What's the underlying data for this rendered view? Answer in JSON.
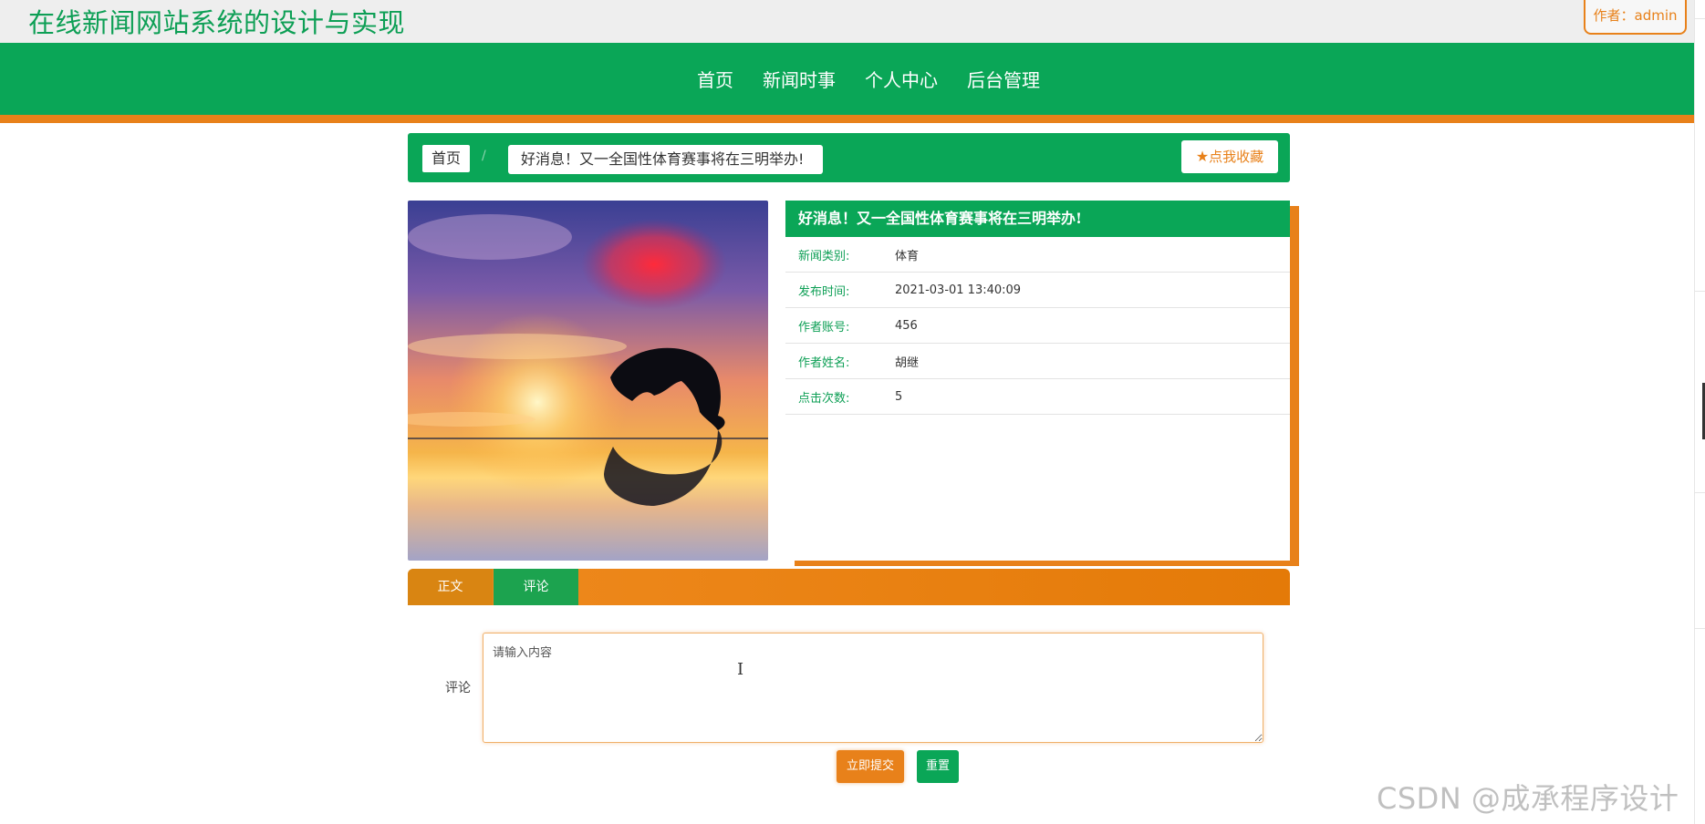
{
  "header": {
    "site_title": "在线新闻网站系统的设计与实现",
    "author_badge": "作者：admin"
  },
  "nav": {
    "items": [
      {
        "label": "首页"
      },
      {
        "label": "新闻时事"
      },
      {
        "label": "个人中心"
      },
      {
        "label": "后台管理"
      }
    ]
  },
  "breadcrumb": {
    "home": "首页",
    "separator": "/",
    "current": "好消息！又一全国性体育赛事将在三明举办!",
    "favorite_icon": "star-icon",
    "favorite_label": "点我收藏"
  },
  "news": {
    "image_alt": "dolphin-sunset-image",
    "title": "好消息！又一全国性体育赛事将在三明举办!",
    "fields": [
      {
        "label": "新闻类别:",
        "value": "体育"
      },
      {
        "label": "发布时间:",
        "value": "2021-03-01 13:40:09"
      },
      {
        "label": "作者账号:",
        "value": "456"
      },
      {
        "label": "作者姓名:",
        "value": "胡继"
      },
      {
        "label": "点击次数:",
        "value": "5"
      }
    ]
  },
  "tabs": [
    {
      "label": "正文"
    },
    {
      "label": "评论"
    }
  ],
  "comment": {
    "label": "评论",
    "placeholder": "请输入内容",
    "value": "",
    "submit_label": "立即提交",
    "reset_label": "重置"
  },
  "watermark": "CSDN @成承程序设计",
  "colors": {
    "primary_green": "#0aa657",
    "accent_orange": "#e8811a"
  }
}
